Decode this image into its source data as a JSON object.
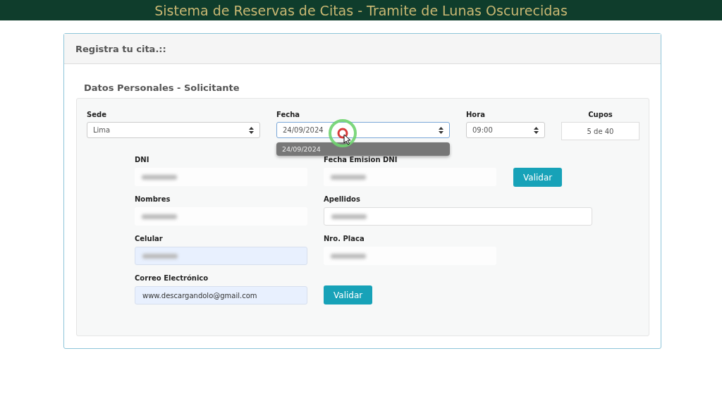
{
  "header": {
    "title": "Sistema de Reservas de Citas - Tramite de Lunas Oscurecidas"
  },
  "card": {
    "title": "Registra tu cita.::",
    "section": "Datos Personales - Solicitante"
  },
  "schedule": [
    {
      "label": "Sede",
      "kind": "select",
      "value": "Lima"
    },
    {
      "label": "Fecha",
      "kind": "select",
      "value": "24/09/2024",
      "expanded": true,
      "options": [
        "24/09/2024"
      ]
    },
    {
      "label": "Hora",
      "kind": "select",
      "value": "09:00"
    },
    {
      "label": "Cupos",
      "kind": "text",
      "value": "5 de 40"
    }
  ],
  "rows": [
    {
      "fields": [
        {
          "label": "DNI",
          "redacted": true,
          "autofilled": false
        },
        {
          "label": "Fecha Emision DNI",
          "redacted": true,
          "autofilled": false
        }
      ],
      "button": "Validar"
    },
    {
      "fields": [
        {
          "label": "Nombres",
          "redacted": true,
          "autofilled": false
        },
        {
          "label": "Apellidos",
          "redacted": true,
          "autofilled": false,
          "wide": true
        }
      ]
    },
    {
      "fields": [
        {
          "label": "Celular",
          "redacted": true,
          "autofilled": true
        },
        {
          "label": "Nro. Placa",
          "redacted": true,
          "autofilled": false
        }
      ]
    },
    {
      "fields": [
        {
          "label": "Correo Electrónico",
          "value": "www.descargandolo@gmail.com",
          "autofilled": true
        }
      ],
      "button": "Validar"
    }
  ]
}
